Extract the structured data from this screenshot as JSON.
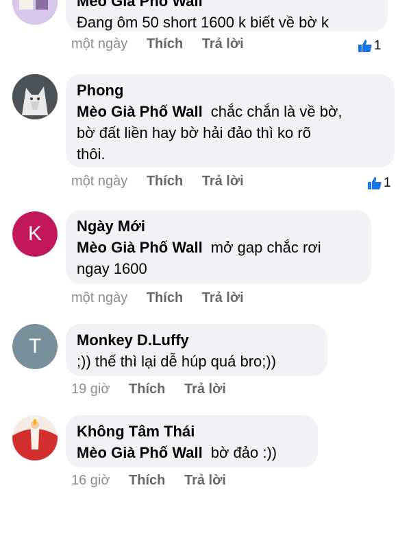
{
  "comments": [
    {
      "author": "Mèo Già Phố Wall",
      "mention": "",
      "text": "Đang ôm 50 short 1600 k biết về bờ k",
      "time": "một ngày",
      "like_label": "Thích",
      "reply_label": "Trả lời",
      "reaction_count": "1",
      "avatar": "illustrated-avatar"
    },
    {
      "author": "Phong",
      "mention": "Mèo Già Phố Wall",
      "text": "chắc chắn là về bờ,",
      "text2": "bờ đất liền hay bờ hải đảo thì ko rõ",
      "text3": "thôi.",
      "time": "một ngày",
      "like_label": "Thích",
      "reply_label": "Trả lời",
      "reaction_count": "1",
      "avatar": "wolf-photo-avatar"
    },
    {
      "author": "Ngày Mới",
      "mention": "Mèo Già Phố Wall",
      "text": "mở gap chắc rơi",
      "text2": "ngay 1600",
      "time": "một ngày",
      "like_label": "Thích",
      "reply_label": "Trả lời",
      "avatar_letter": "K",
      "avatar_color": "#c2185b"
    },
    {
      "author": "Monkey D.Luffy",
      "text": ";)) thế thì lại dễ húp quá bro;))",
      "time": "19 giờ",
      "like_label": "Thích",
      "reply_label": "Trả lời",
      "avatar_letter": "T",
      "avatar_color": "#78909c"
    },
    {
      "author": "Không Tâm Thái",
      "mention": "Mèo Già Phố Wall",
      "text": "bờ đảo :))",
      "time": "16 giờ",
      "like_label": "Thích",
      "reply_label": "Trả lời",
      "avatar": "red-illustrated-avatar"
    }
  ],
  "colors": {
    "bubble": "#f0f2f5",
    "meta_text": "#65676b",
    "like_blue": "#1b74e4"
  }
}
